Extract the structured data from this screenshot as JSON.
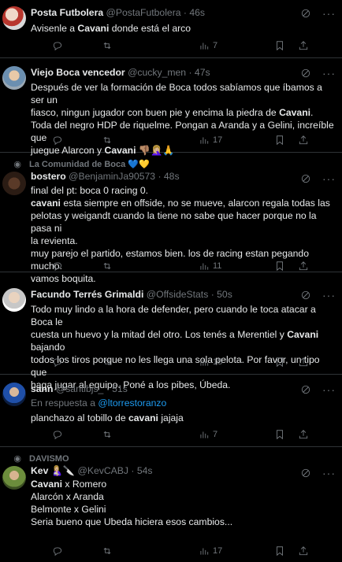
{
  "tweets": [
    {
      "name": "Posta Futbolera",
      "handle": "@PostaFutbolera",
      "time": "46s",
      "lines": [
        [
          {
            "t": "Avisenle a "
          },
          {
            "t": "Cavani",
            "b": true
          },
          {
            "t": " donde está el arco"
          }
        ]
      ],
      "views": "7"
    },
    {
      "name": "Viejo Boca vencedor",
      "handle": "@cucky_men",
      "time": "47s",
      "lines": [
        [
          {
            "t": "Después de ver la formación de Boca todos sabíamos que íbamos a ser un"
          }
        ],
        [
          {
            "t": "fiasco, ningun jugador con buen pie y encima la piedra de "
          },
          {
            "t": "Cavani",
            "b": true
          },
          {
            "t": "."
          }
        ],
        [
          {
            "t": "Toda del negro HDP de riquelme. Pongan a Aranda y a  Gelini, increíble que"
          }
        ],
        [
          {
            "t": "juegue Alarcon y "
          },
          {
            "t": "Cavani",
            "b": true
          },
          {
            "t": " 👎🏽🤦🏼‍♀️🙏"
          }
        ]
      ],
      "views": "17"
    },
    {
      "social": "La Comunidad de Boca 💙💛",
      "name": "bostero",
      "handle": "@BenjaminJa90573",
      "time": "48s",
      "lines": [
        [
          {
            "t": "final del pt: boca 0 racing 0."
          }
        ],
        [
          {
            "t": "cavani",
            "b": true
          },
          {
            "t": " esta siempre en offside, no se mueve, alarcon regala todas las"
          }
        ],
        [
          {
            "t": "pelotas y weigandt cuando la tiene no sabe que hacer porque no la pasa ni"
          }
        ],
        [
          {
            "t": "la revienta."
          }
        ],
        [
          {
            "t": "muy parejo el partido, estamos bien. los de racing estan pegando mucho."
          }
        ],
        [
          {
            "t": "vamos boquita."
          }
        ]
      ],
      "views": "11"
    },
    {
      "name": "Facundo Terrés Grimaldi",
      "handle": "@OffsideStats",
      "time": "50s",
      "lines": [
        [
          {
            "t": "Todo muy lindo a la hora de defender, pero cuando le toca atacar a Boca le"
          }
        ],
        [
          {
            "t": "cuesta un huevo y la mitad del otro. Los tenés a Merentiel y "
          },
          {
            "t": "Cavani",
            "b": true
          },
          {
            "t": " bajando"
          }
        ],
        [
          {
            "t": "todos los tiros porque no les llega una sola pelota. Por favor, un tipo que"
          }
        ],
        [
          {
            "t": "haga jugar al equipo. Poné a los pibes, Úbeda."
          }
        ]
      ],
      "views": "15"
    },
    {
      "name": "sann",
      "handle": "@santibjs_",
      "time": "51s",
      "reply_prefix": "En respuesta a ",
      "reply_to": "@ltorrestoranzo",
      "lines": [
        [
          {
            "t": "planchazo al tobillo de "
          },
          {
            "t": "cavani",
            "b": true
          },
          {
            "t": " jajaja"
          }
        ]
      ],
      "views": "7"
    },
    {
      "social": "DAVISMO",
      "name": "Kev 🤱🏼🔪",
      "handle": "@KevCABJ",
      "time": "54s",
      "lines": [
        [
          {
            "t": "Cavani",
            "b": true
          },
          {
            "t": " x Romero"
          }
        ],
        [
          {
            "t": "Alarcón x Aranda"
          }
        ],
        [
          {
            "t": "Belmonte x Gelini"
          }
        ],
        [
          {
            "t": " "
          }
        ],
        [
          {
            "t": "Seria bueno que Ubeda hiciera esos cambios..."
          }
        ]
      ],
      "views": "17"
    }
  ],
  "icons": [
    "reply-icon",
    "retweet-icon",
    "like-icon",
    "views-icon",
    "bookmark-icon",
    "share-icon",
    "grok-icon",
    "more-icon"
  ]
}
